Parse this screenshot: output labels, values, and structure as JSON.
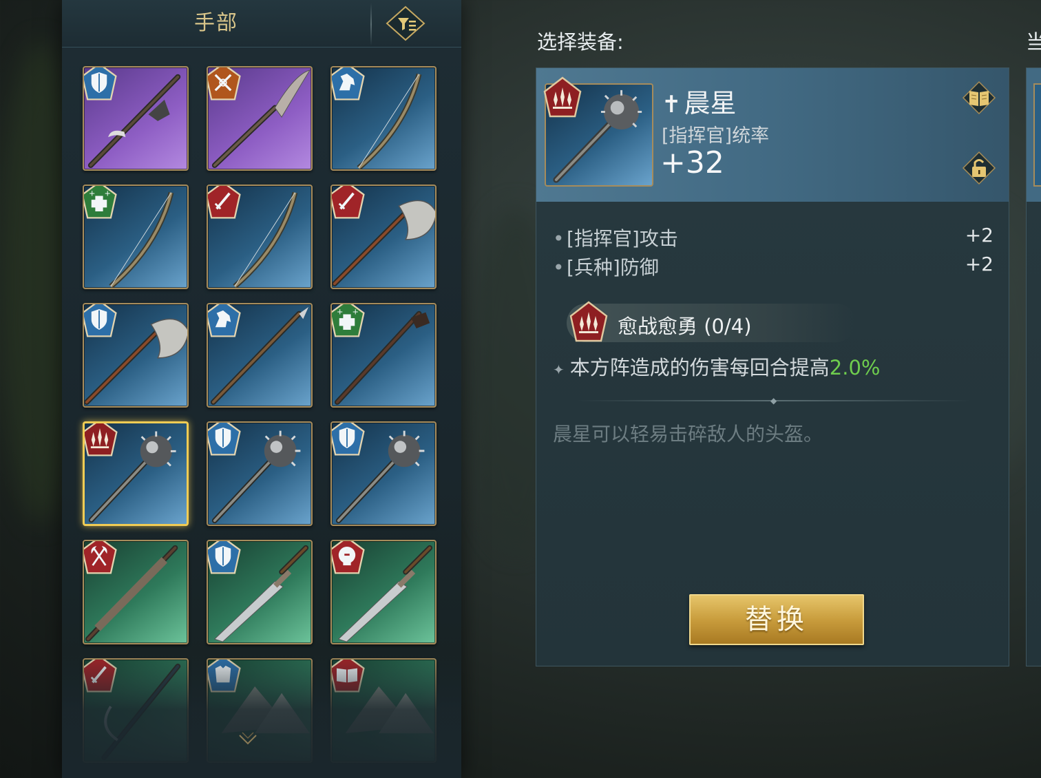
{
  "inventory": {
    "title": "手部",
    "filter_icon": "filter-icon",
    "items": [
      {
        "quality": "purple",
        "badge": "shield-badge",
        "weapon": "halberd"
      },
      {
        "quality": "purple",
        "badge": "crossed-swords-badge",
        "weapon": "glaive"
      },
      {
        "quality": "blue",
        "badge": "horse-badge",
        "weapon": "bow"
      },
      {
        "quality": "blue",
        "badge": "heal-badge",
        "weapon": "bow"
      },
      {
        "quality": "blue",
        "badge": "sword-badge",
        "weapon": "bow"
      },
      {
        "quality": "blue",
        "badge": "sword-badge",
        "weapon": "axe"
      },
      {
        "quality": "blue",
        "badge": "shield-badge",
        "weapon": "axe"
      },
      {
        "quality": "blue",
        "badge": "horse-badge",
        "weapon": "spear"
      },
      {
        "quality": "blue",
        "badge": "heal-badge",
        "weapon": "staff"
      },
      {
        "quality": "blue",
        "badge": "spikes-badge",
        "weapon": "morningstar",
        "selected": true
      },
      {
        "quality": "blue",
        "badge": "shield-badge",
        "weapon": "morningstar"
      },
      {
        "quality": "blue",
        "badge": "shield-badge",
        "weapon": "morningstar"
      },
      {
        "quality": "green",
        "badge": "axes-badge",
        "weapon": "sword"
      },
      {
        "quality": "green",
        "badge": "shield-badge",
        "weapon": "dagger"
      },
      {
        "quality": "green",
        "badge": "helmet-badge",
        "weapon": "dagger"
      },
      {
        "quality": "green",
        "badge": "sword-badge",
        "weapon": "scythe"
      },
      {
        "quality": "green",
        "badge": "armor-badge",
        "weapon": "rocks"
      },
      {
        "quality": "green",
        "badge": "book-badge",
        "weapon": "rocks"
      }
    ]
  },
  "detail": {
    "select_label": "选择装备:",
    "name_prefix": "✝",
    "name": "晨星",
    "main_stat_label": "[指挥官]统率",
    "main_stat_value": "+32",
    "stats": [
      {
        "label": "[指挥官]攻击",
        "value": "+2"
      },
      {
        "label": "[兵种]防御",
        "value": "+2"
      }
    ],
    "skill_name": "愈战愈勇 (0/4)",
    "skill_desc_prefix": "本方阵造成的伤害每回合提高",
    "skill_desc_value": "2.0%",
    "flavor_text": "晨星可以轻易击碎敌人的头盔。",
    "replace_button": "替换"
  },
  "right_edge": {
    "label_fragment": "当"
  },
  "colors": {
    "gold_accent": "#d9c58a",
    "highlight_green": "#6fce4e",
    "selected_border": "#f1cc54",
    "button_gold": "#c99d3d"
  }
}
